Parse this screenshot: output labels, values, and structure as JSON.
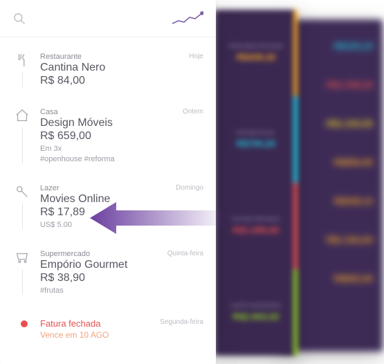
{
  "colors": {
    "orange": "#f5a623",
    "cyan": "#1ecbe1",
    "red": "#e94f4f",
    "green": "#8fd41f",
    "yellow": "#f5d623",
    "purple": "#6b3fa0"
  },
  "back2": {
    "rows": [
      {
        "value": "R$193,10",
        "color": "#1ecbe1"
      },
      {
        "value": "R$1.058,00",
        "color": "#e94f4f"
      },
      {
        "value": "R$1.243,50",
        "color": "#f5d623"
      },
      {
        "value": "R$856,00",
        "color": "#f5a623"
      },
      {
        "value": "R$249,13",
        "color": "#f5a623"
      },
      {
        "value": "R$1.204,00",
        "color": "#f5a623"
      },
      {
        "value": "R$902,00",
        "color": "#f5a623"
      }
    ]
  },
  "back1": {
    "segments": [
      {
        "label": "PRÓXIMAS FATURAS",
        "value": "R$439,32",
        "color": "#f5a623",
        "stripe": "#f5a623"
      },
      {
        "label": "FATURA ATUAL",
        "value": "R$700,20",
        "color": "#1ecbe1",
        "stripe": "#1ecbe1"
      },
      {
        "label": "FATURA FECHADA",
        "value": "R$1.098,90",
        "color": "#e94f4f",
        "stripe": "#e94f4f"
      },
      {
        "label": "LIMITE DISPONÍVEL",
        "value": "R$2.663,52",
        "color": "#8fd41f",
        "stripe": "#8fd41f"
      }
    ]
  },
  "front": {
    "items": [
      {
        "icon": "utensils-icon",
        "category": "Restaurante",
        "merchant": "Cantina Nero",
        "amount": "R$ 84,00",
        "when": "Hoje"
      },
      {
        "icon": "home-icon",
        "category": "Casa",
        "merchant": "Design Móveis",
        "amount": "R$ 659,00",
        "sub": "Em 3x",
        "tags": "#openhouse  #reforma",
        "when": "Ontem"
      },
      {
        "icon": "leisure-icon",
        "category": "Lazer",
        "merchant": "Movies Online",
        "amount": "R$ 17,89",
        "sub": "US$ 5.00",
        "when": "Domingo"
      },
      {
        "icon": "cart-icon",
        "category": "Supermercado",
        "merchant": "Empório Gourmet",
        "amount": "R$ 38,90",
        "tags": "#frutas",
        "when": "Quinta-feira"
      }
    ],
    "closed": {
      "title": "Fatura fechada",
      "due": "Vence em 10 AGO",
      "when": "Segunda-feira"
    }
  }
}
